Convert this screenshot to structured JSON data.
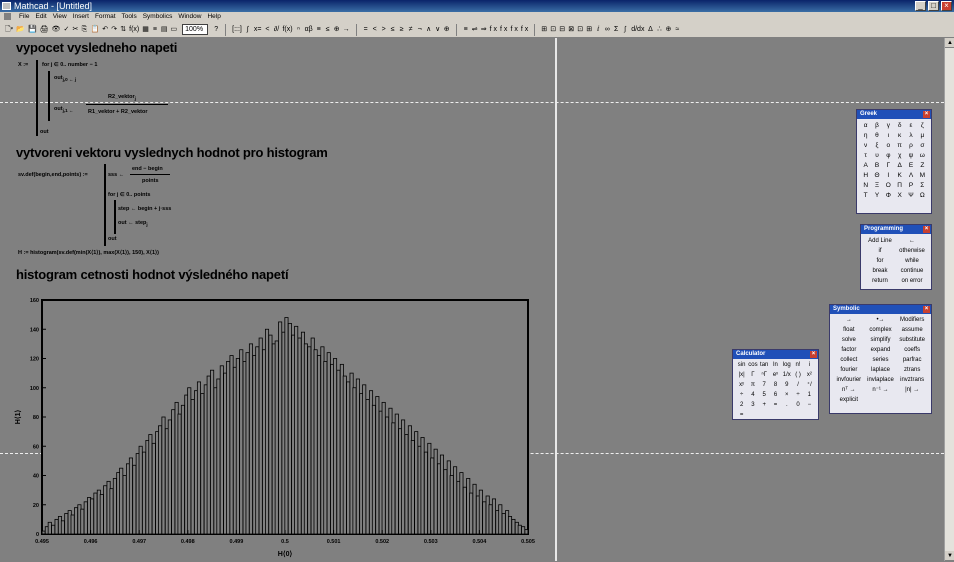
{
  "window": {
    "title": "Mathcad - [Untitled]"
  },
  "menu": [
    "File",
    "Edit",
    "View",
    "Insert",
    "Format",
    "Tools",
    "Symbolics",
    "Window",
    "Help"
  ],
  "toolbar": {
    "left_icons": [
      "🗋▾",
      "📂",
      "💾",
      "🖨",
      "👁",
      "✓",
      "✂",
      "⎘",
      "📋",
      "↶",
      "↷",
      "⇅",
      "f(x)",
      "▦",
      "≡",
      "▤",
      "▭"
    ],
    "zoom": "100%",
    "help": "?",
    "math_icons": [
      "[:::]",
      "∫",
      "x=",
      "<",
      "∂/",
      "f(x)",
      "ⁿ",
      "αβ",
      "≡",
      "≤",
      "⊕",
      "→"
    ],
    "bool_ops": [
      "=",
      "<",
      ">",
      "≤",
      "≥",
      "≠",
      "¬",
      "∧",
      "∨",
      "⊕"
    ],
    "sym_ops": [
      "→",
      "•→",
      "Modifiers",
      "float",
      "complex",
      "assume"
    ],
    "extra_ops": [
      "≡",
      "⇌",
      "⇒",
      "f x",
      "f x",
      "f x",
      "f x"
    ],
    "tail_icons": [
      "⊞",
      "⊡",
      "⊟",
      "⊠",
      "⊡",
      "⊞",
      "ⅈ",
      "∞",
      "Σ",
      "∫",
      "d/dx",
      "Δ",
      "∴",
      "⊕",
      "≈"
    ]
  },
  "worksheet": {
    "h1": "vypocet vysledneho napeti",
    "h2": "vytvoreni vektoru vyslednych hodnot pro histogram",
    "h3": "histogram cetnosti hodnot výsledného napetí",
    "m1": {
      "lhs": "X :=",
      "for": "for j ∈ 0.. number − 1",
      "line2": "out",
      "sub1": "j,0 ← j",
      "sub2": "j,1 ←",
      "num": "R2_vektor",
      "den": "R1_vektor  + R2_vektor",
      "jsub": "j",
      "ret": "out"
    },
    "m2": {
      "lhs": "sv.def(begin,end,points) :=",
      "l1": "sss ←",
      "l1num": "end − begin",
      "l1den": "points",
      "l2": "for j ∈ 0.. points",
      "l3": "step ← begin + j·sss",
      "l4": "out  ← step",
      "l4sub": "j",
      "l5": "out"
    },
    "m3": "H := histogram(sv.def(min(X⟨1⟩), max(X⟨1⟩), 150), X⟨1⟩)"
  },
  "chart_data": {
    "type": "bar",
    "xlabel": "H⟨0⟩",
    "ylabel": "H⟨1⟩",
    "xlim": [
      0.495,
      0.505
    ],
    "ylim": [
      0,
      160
    ],
    "xticks": [
      "0.495",
      "0.496",
      "0.497",
      "0.498",
      "0.499",
      "0.5",
      "0.501",
      "0.502",
      "0.503",
      "0.504",
      "0.505"
    ],
    "yticks": [
      "0",
      "20",
      "40",
      "60",
      "80",
      "100",
      "120",
      "140",
      "160"
    ],
    "x": [
      0.49503,
      0.4951,
      0.49516,
      0.49523,
      0.4953,
      0.49537,
      0.49543,
      0.4955,
      0.49557,
      0.49563,
      0.4957,
      0.49577,
      0.49583,
      0.4959,
      0.49597,
      0.49603,
      0.4961,
      0.49617,
      0.49623,
      0.4963,
      0.49637,
      0.49643,
      0.4965,
      0.49657,
      0.49663,
      0.4967,
      0.49677,
      0.49683,
      0.4969,
      0.49697,
      0.49703,
      0.4971,
      0.49717,
      0.49723,
      0.4973,
      0.49737,
      0.49743,
      0.4975,
      0.49757,
      0.49763,
      0.4977,
      0.49777,
      0.49783,
      0.4979,
      0.49797,
      0.49803,
      0.4981,
      0.49817,
      0.49823,
      0.4983,
      0.49837,
      0.49843,
      0.4985,
      0.49857,
      0.49863,
      0.4987,
      0.49877,
      0.49883,
      0.4989,
      0.49897,
      0.49903,
      0.4991,
      0.49917,
      0.49923,
      0.4993,
      0.49937,
      0.49943,
      0.4995,
      0.49957,
      0.49963,
      0.4997,
      0.49977,
      0.49983,
      0.4999,
      0.49997,
      0.50003,
      0.5001,
      0.50017,
      0.50023,
      0.5003,
      0.50037,
      0.50043,
      0.5005,
      0.50057,
      0.50063,
      0.5007,
      0.50077,
      0.50083,
      0.5009,
      0.50097,
      0.50103,
      0.5011,
      0.50117,
      0.50123,
      0.5013,
      0.50137,
      0.50143,
      0.5015,
      0.50157,
      0.50163,
      0.5017,
      0.50177,
      0.50183,
      0.5019,
      0.50197,
      0.50203,
      0.5021,
      0.50217,
      0.50223,
      0.5023,
      0.50237,
      0.50243,
      0.5025,
      0.50257,
      0.50263,
      0.5027,
      0.50277,
      0.50283,
      0.5029,
      0.50297,
      0.50303,
      0.5031,
      0.50317,
      0.50323,
      0.5033,
      0.50337,
      0.50343,
      0.5035,
      0.50357,
      0.50363,
      0.5037,
      0.50377,
      0.50383,
      0.5039,
      0.50397,
      0.50403,
      0.5041,
      0.50417,
      0.50423,
      0.5043,
      0.50437,
      0.50443,
      0.5045,
      0.50457,
      0.50463,
      0.5047,
      0.50477,
      0.50483,
      0.5049,
      0.50497
    ],
    "values": [
      2,
      5,
      8,
      6,
      10,
      12,
      9,
      14,
      16,
      13,
      18,
      20,
      17,
      22,
      25,
      24,
      28,
      30,
      27,
      33,
      36,
      31,
      38,
      42,
      45,
      40,
      48,
      52,
      47,
      55,
      60,
      56,
      64,
      68,
      62,
      70,
      74,
      80,
      72,
      78,
      85,
      90,
      82,
      88,
      95,
      100,
      92,
      98,
      104,
      96,
      102,
      108,
      112,
      100,
      106,
      115,
      110,
      118,
      122,
      114,
      120,
      126,
      118,
      124,
      130,
      122,
      128,
      134,
      126,
      140,
      136,
      130,
      132,
      145,
      138,
      148,
      144,
      136,
      142,
      134,
      138,
      130,
      128,
      134,
      126,
      122,
      128,
      118,
      124,
      116,
      120,
      112,
      116,
      108,
      104,
      110,
      100,
      106,
      96,
      102,
      92,
      98,
      88,
      94,
      84,
      90,
      80,
      86,
      76,
      82,
      72,
      78,
      68,
      74,
      64,
      70,
      60,
      66,
      56,
      62,
      52,
      58,
      48,
      54,
      44,
      50,
      40,
      46,
      36,
      42,
      32,
      38,
      28,
      34,
      26,
      30,
      22,
      26,
      20,
      24,
      16,
      20,
      14,
      16,
      12,
      10,
      8,
      6,
      5,
      3
    ]
  },
  "palettes": {
    "greek": {
      "title": "Greek",
      "cells": [
        "α",
        "β",
        "γ",
        "δ",
        "ε",
        "ζ",
        "η",
        "θ",
        "ι",
        "κ",
        "λ",
        "μ",
        "ν",
        "ξ",
        "ο",
        "π",
        "ρ",
        "σ",
        "τ",
        "υ",
        "φ",
        "χ",
        "ψ",
        "ω",
        "Α",
        "Β",
        "Γ",
        "Δ",
        "Ε",
        "Ζ",
        "Η",
        "Θ",
        "Ι",
        "Κ",
        "Λ",
        "Μ",
        "Ν",
        "Ξ",
        "Ο",
        "Π",
        "Ρ",
        "Σ",
        "Τ",
        "Υ",
        "Φ",
        "Χ",
        "Ψ",
        "Ω"
      ]
    },
    "programming": {
      "title": "Programming",
      "cells": [
        "Add Line",
        "←",
        "if",
        "otherwise",
        "for",
        "while",
        "break",
        "continue",
        "return",
        "on error"
      ]
    },
    "symbolic": {
      "title": "Symbolic",
      "cells": [
        "→",
        "•→",
        "Modifiers",
        "float",
        "complex",
        "assume",
        "solve",
        "simplify",
        "substitute",
        "factor",
        "expand",
        "coeffs",
        "collect",
        "series",
        "parfrac",
        "fourier",
        "laplace",
        "ztrans",
        "invfourier",
        "invlaplace",
        "invztrans",
        "nᵀ →",
        "n⁻¹ →",
        "|n| →",
        "explicit",
        "",
        ""
      ]
    },
    "calculator": {
      "title": "Calculator",
      "cells": [
        "sin",
        "cos",
        "tan",
        "ln",
        "log",
        "n!",
        "i",
        "|x|",
        "Γ",
        "ⁿΓ",
        "eˣ",
        "1/x",
        "( )",
        "x²",
        "xʸ",
        "π",
        "7",
        "8",
        "9",
        "/",
        "⁺/",
        "÷",
        "4",
        "5",
        "6",
        "×",
        "÷",
        "1",
        "2",
        "3",
        "+",
        "=",
        ".",
        "0",
        "−",
        "="
      ]
    }
  },
  "colors": {
    "titlebar": "#0a246a",
    "worksheet": "#808080",
    "palette_title": "#2050b8",
    "close": "#c84030"
  }
}
